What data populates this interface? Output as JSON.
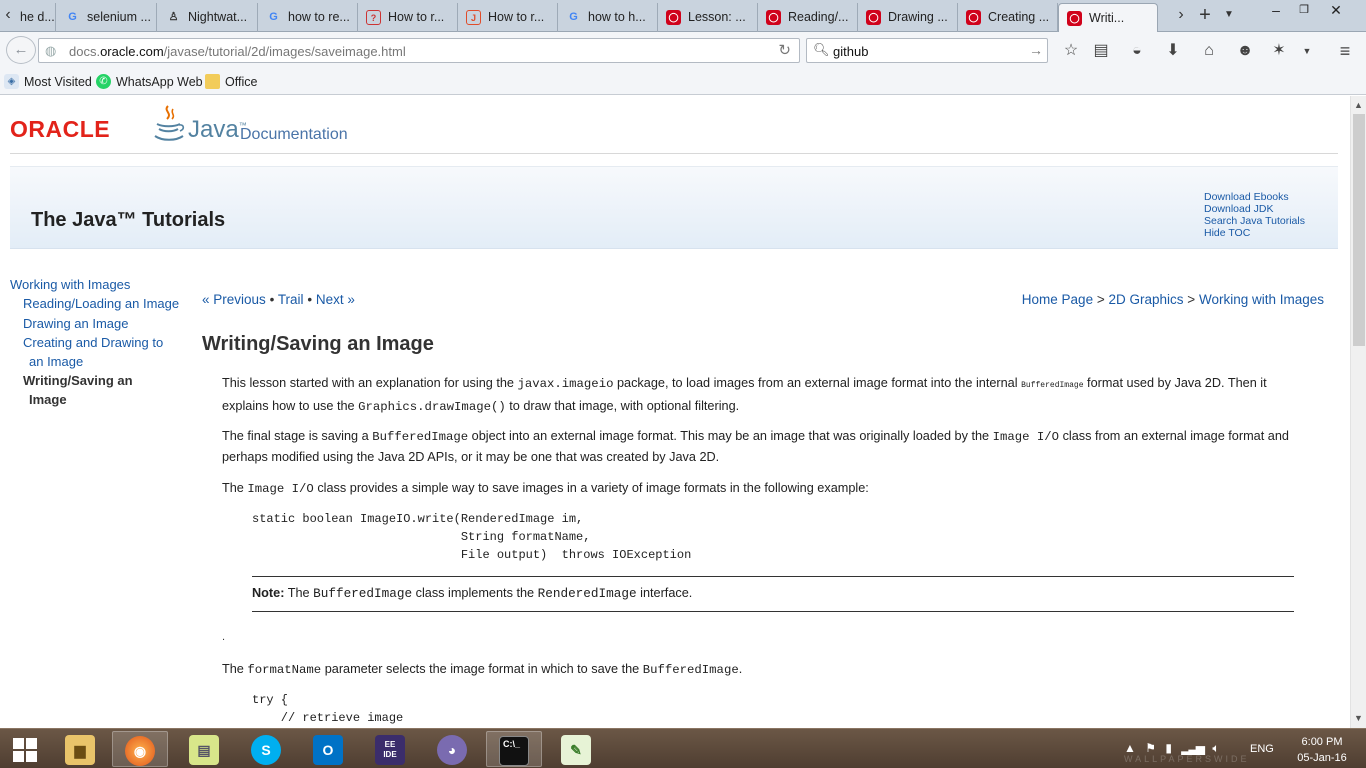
{
  "tabs": [
    {
      "label": "he d...",
      "icon": "partial-tab-icon"
    },
    {
      "label": "selenium ...",
      "icon": "google-icon"
    },
    {
      "label": "Nightwat...",
      "icon": "nightwatch-icon"
    },
    {
      "label": "how to re...",
      "icon": "google-icon"
    },
    {
      "label": "How to r...",
      "icon": "question-icon"
    },
    {
      "label": "How to r...",
      "icon": "j-icon"
    },
    {
      "label": "how to h...",
      "icon": "google-icon"
    },
    {
      "label": "Lesson: ...",
      "icon": "oracle-icon"
    },
    {
      "label": "Reading/...",
      "icon": "oracle-icon"
    },
    {
      "label": "Drawing ...",
      "icon": "oracle-icon"
    },
    {
      "label": "Creating ...",
      "icon": "oracle-icon"
    },
    {
      "label": "Writi...",
      "icon": "oracle-icon"
    }
  ],
  "navbar": {
    "url_prefix": "docs.",
    "url_domain": "oracle.com",
    "url_path": "/javase/tutorial/2d/images/saveimage.html",
    "search_value": "github"
  },
  "bookmarks": {
    "most_visited": "Most Visited",
    "whatsapp": "WhatsApp Web",
    "office": "Office"
  },
  "header": {
    "oracle_logo": "ORACLE",
    "java_logo": "Java",
    "doc_label": "Documentation",
    "banner_title": "The Java™ Tutorials",
    "banner_links": [
      "Download Ebooks",
      "Download JDK",
      "Search Java Tutorials",
      "Hide TOC"
    ]
  },
  "toc": {
    "parent": "Working with Images",
    "items": [
      {
        "line1": "Reading/Loading an Image",
        "line2": ""
      },
      {
        "line1": "Drawing an Image",
        "line2": ""
      },
      {
        "line1": "Creating and Drawing to",
        "line2": "an Image"
      },
      {
        "line1": "Writing/Saving an",
        "line2": "Image",
        "current": true
      }
    ]
  },
  "nav": {
    "previous": "« Previous",
    "sep": "•",
    "trail": "Trail",
    "next": "Next »"
  },
  "breadcrumb": {
    "home": "Home Page",
    "gt": ">",
    "section": "2D Graphics",
    "page": "Working with Images"
  },
  "content": {
    "title": "Writing/Saving an Image",
    "p1": {
      "a": "This lesson started with an explanation for using the ",
      "code1": "javax.imageio",
      "b": " package, to load images from an external image format into the internal ",
      "code2": "BufferedImage",
      "c": " format used by Java 2D. Then it explains how to use the ",
      "code3": "Graphics.drawImage()",
      "d": " to draw that image, with optional filtering."
    },
    "p2": {
      "a": "The final stage is saving a ",
      "code1": "BufferedImage",
      "b": " object into an external image format. This may be an image that was originally loaded by the ",
      "code2": "Image I/O",
      "c": " class from an external image format and perhaps modified using the Java 2D APIs, or it may be one that was created by Java 2D."
    },
    "p3": {
      "a": "The ",
      "code1": "Image I/O",
      "b": " class provides a simple way to save images in a variety of image formats in the following example:"
    },
    "code_block1": [
      "static boolean ImageIO.write(RenderedImage im,",
      "                             String formatName,",
      "                             File output)  throws IOException"
    ],
    "note": {
      "label": "Note:",
      "a": " The ",
      "code1": "BufferedImage",
      "b": " class implements the ",
      "code2": "RenderedImage",
      "c": " interface."
    },
    "dot": ".",
    "p4": {
      "a": "The ",
      "code1": "formatName",
      "b": " parameter selects the image format in which to save the ",
      "code2": "BufferedImage",
      "c": "."
    },
    "code_block2": [
      "try {",
      "    // retrieve image"
    ]
  },
  "taskbar": {
    "lang": "ENG",
    "time": "6:00 PM",
    "date": "05-Jan-16",
    "watermark": "WALLPAPERSWIDE"
  }
}
